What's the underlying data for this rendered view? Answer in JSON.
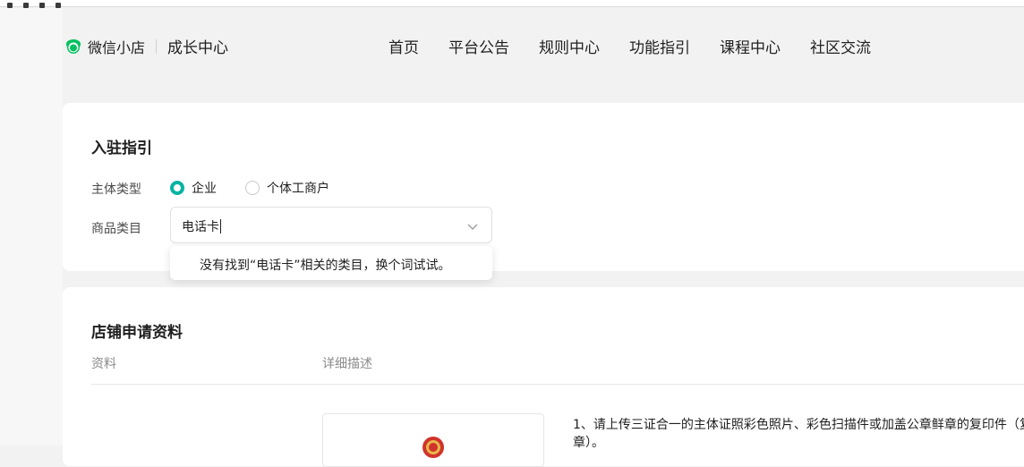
{
  "header": {
    "logo_text": "微信小店",
    "sub_title": "成长中心",
    "nav": [
      "首页",
      "平台公告",
      "规则中心",
      "功能指引",
      "课程中心",
      "社区交流"
    ]
  },
  "entry_card": {
    "title": "入驻指引",
    "entity_type_label": "主体类型",
    "entity_options": [
      {
        "label": "企业",
        "checked": true
      },
      {
        "label": "个体工商户",
        "checked": false
      }
    ],
    "category_label": "商品类目",
    "category_input_value": "电话卡",
    "dropdown_message": "没有找到“电话卡”相关的类目，换个词试试。"
  },
  "materials_card": {
    "title": "店铺申请资料",
    "col_material": "资料",
    "col_description": "详细描述",
    "desc_line1": "1、请上传三证合一的主体证照彩色照片、彩色扫描件或加盖公章鲜章的复印件（复",
    "desc_line2": "章）。"
  },
  "colors": {
    "accent": "#07b3a3",
    "logo_green": "#07c160",
    "emblem_red": "#d0342c"
  }
}
